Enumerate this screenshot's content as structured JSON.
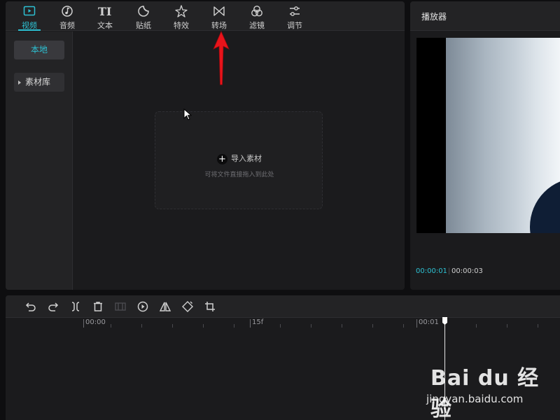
{
  "toolbar": {
    "tabs": [
      {
        "label": "视频",
        "icon": "video-icon",
        "active": true
      },
      {
        "label": "音频",
        "icon": "music-note-icon",
        "active": false
      },
      {
        "label": "文本",
        "icon": "text-icon",
        "active": false
      },
      {
        "label": "贴纸",
        "icon": "sticker-icon",
        "active": false
      },
      {
        "label": "特效",
        "icon": "sparkle-icon",
        "active": false
      },
      {
        "label": "转场",
        "icon": "transition-icon",
        "active": false
      },
      {
        "label": "滤镜",
        "icon": "filter-icon",
        "active": false
      },
      {
        "label": "调节",
        "icon": "adjust-sliders-icon",
        "active": false
      }
    ]
  },
  "sidebar": {
    "local_label": "本地",
    "library_label": "素材库"
  },
  "dropzone": {
    "import_label": "导入素材",
    "hint": "可将文件直接拖入到此处"
  },
  "player": {
    "title": "播放器",
    "current_time": "00:00:01",
    "duration": "00:00:03"
  },
  "timeline": {
    "tools": [
      "undo-icon",
      "redo-icon",
      "split-icon",
      "delete-icon",
      "freeze-icon",
      "play-reverse-icon",
      "mirror-icon",
      "rotate-icon",
      "crop-icon"
    ],
    "ruler_labels": [
      "00:00",
      "15f",
      "00:01"
    ]
  },
  "watermark": {
    "logo": "Bai du 经验",
    "url": "jingyan.baidu.com"
  },
  "colors": {
    "accent": "#2dc1d3",
    "panel": "#1b1b1d",
    "arrow": "#e8141b"
  }
}
